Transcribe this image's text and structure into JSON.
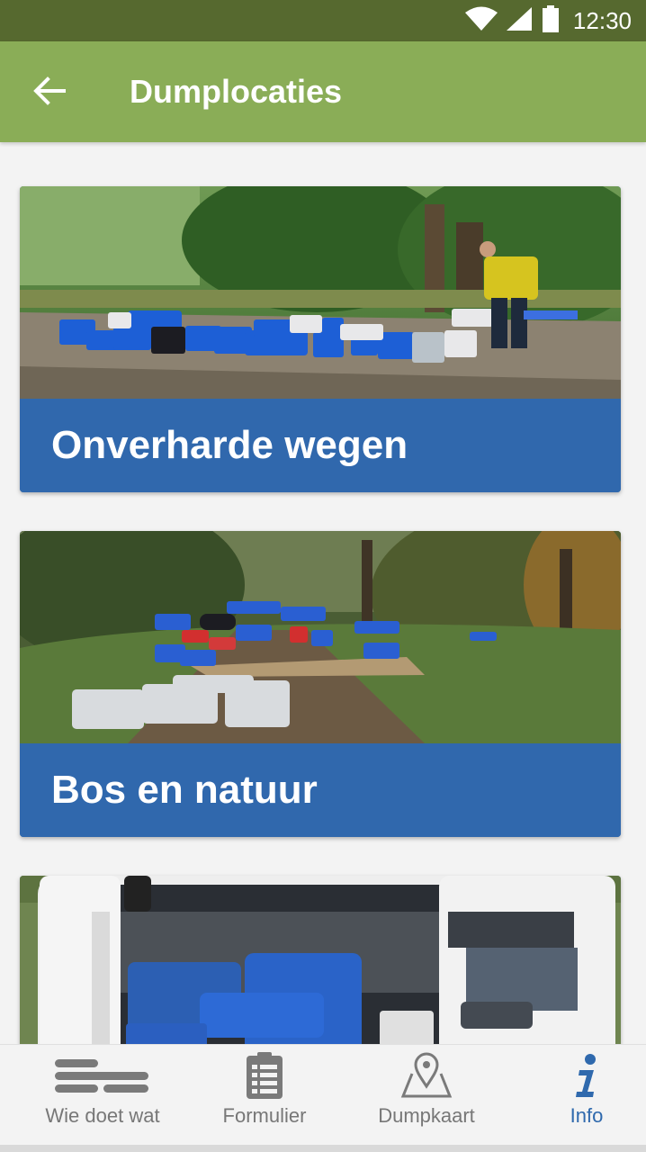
{
  "status_bar": {
    "time": "12:30",
    "icons": [
      "wifi-icon",
      "signal-icon",
      "battery-icon"
    ]
  },
  "app_bar": {
    "title": "Dumplocaties",
    "back_icon": "arrow-left-icon"
  },
  "cards": [
    {
      "label": "Onverharde wegen",
      "image": "canisters-on-dirt-road-photo"
    },
    {
      "label": "Bos en natuur",
      "image": "canisters-in-forest-photo"
    },
    {
      "label": "",
      "image": "van-loaded-with-canisters-photo"
    }
  ],
  "bottom_nav": {
    "items": [
      {
        "label": "Wie doet wat",
        "icon": "list-lines-icon",
        "active": false
      },
      {
        "label": "Formulier",
        "icon": "clipboard-form-icon",
        "active": false
      },
      {
        "label": "Dumpkaart",
        "icon": "map-pin-icon",
        "active": false
      },
      {
        "label": "Info",
        "icon": "info-icon",
        "active": true
      }
    ]
  },
  "colors": {
    "status_bar": "#56692f",
    "app_bar": "#8aad57",
    "card_band": "#3068ad",
    "nav_active": "#2f69ad",
    "nav_inactive": "#777777"
  }
}
